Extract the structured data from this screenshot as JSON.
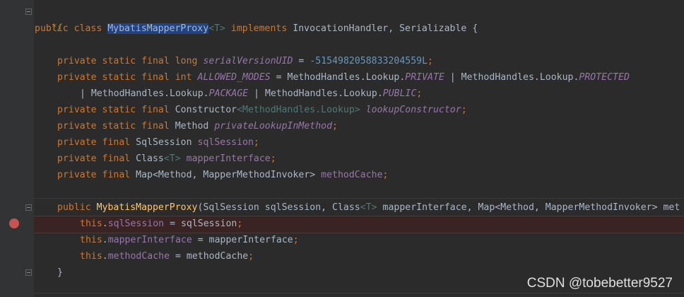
{
  "editor": {
    "line1": "*/",
    "class_decl": {
      "kw1": "public class ",
      "name": "MybatisMapperProxy",
      "gen1": "<T>",
      "kw2": " implements ",
      "rest": "InvocationHandler, Serializable {"
    },
    "field1": {
      "kw": "private static final long ",
      "name": "serialVersionUID",
      "eq": " = ",
      "val": "-5154982058833204559L",
      "end": ";"
    },
    "field2": {
      "kw": "private static final int ",
      "name": "ALLOWED_MODES",
      "mid": " = MethodHandles.Lookup.",
      "c1": "PRIVATE",
      "mid2": " | MethodHandles.Lookup.",
      "c2": "PROTECTED"
    },
    "field2b": {
      "pre": "| MethodHandles.Lookup.",
      "c3": "PACKAGE",
      "mid": " | MethodHandles.Lookup.",
      "c4": "PUBLIC",
      "end": ";"
    },
    "field3": {
      "kw": "private static final ",
      "type": "Constructor",
      "g": "<MethodHandles.Lookup>",
      "sp": " ",
      "name": "lookupConstructor",
      "end": ";"
    },
    "field4": {
      "kw": "private static final ",
      "type": "Method ",
      "name": "privateLookupInMethod",
      "end": ";"
    },
    "field5": {
      "kw": "private final ",
      "type": "SqlSession ",
      "name": "sqlSession",
      "end": ";"
    },
    "field6": {
      "kw": "private final ",
      "type": "Class",
      "g": "<T>",
      "sp": " ",
      "name": "mapperInterface",
      "end": ";"
    },
    "field7": {
      "kw": "private final ",
      "type": "Map<Method, MapperMethodInvoker> ",
      "name": "methodCache",
      "end": ";"
    },
    "ctor": {
      "kw": "public ",
      "name": "MybatisMapperProxy",
      "p1": "(SqlSession sqlSession, Class",
      "g": "<T>",
      "p2": " mapperInterface, Map<Method, MapperMethodInvoker> met"
    },
    "assign1": {
      "t": "this",
      "dot": ".",
      "f": "sqlSession",
      "rest": " = sqlSession",
      "end": ";"
    },
    "assign2": {
      "t": "this",
      "dot": ".",
      "f": "mapperInterface",
      "rest": " = mapperInterface",
      "end": ";"
    },
    "assign3": {
      "t": "this",
      "dot": ".",
      "f": "methodCache",
      "rest": " = methodCache",
      "end": ";"
    },
    "close": "}"
  },
  "watermark": "CSDN @tobebetter9527"
}
